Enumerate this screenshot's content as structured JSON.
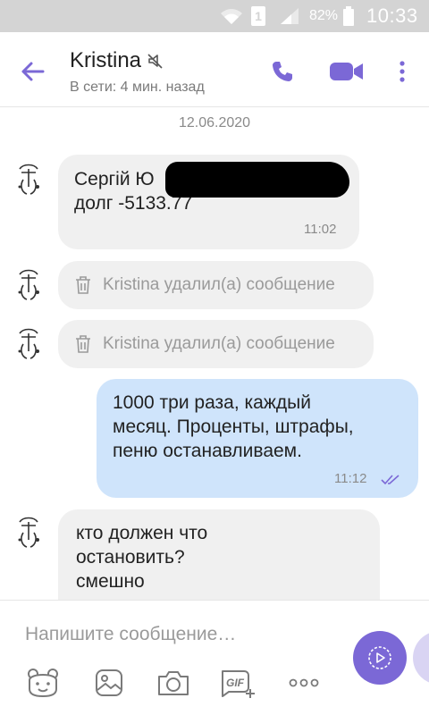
{
  "status_bar": {
    "battery_percent": "82%",
    "time": "10:33",
    "sim_label": "1"
  },
  "header": {
    "contact_name": "Kristina",
    "last_seen": "В сети: 4 мин. назад"
  },
  "conversation": {
    "date_separator": "12.06.2020",
    "messages": [
      {
        "direction": "in",
        "line1": "Сергій Ю",
        "line2": "долг -5133.77",
        "time": "11:02"
      },
      {
        "direction": "in",
        "deleted": true,
        "text": "Kristina удалил(а) сообщение"
      },
      {
        "direction": "in",
        "deleted": true,
        "text": "Kristina удалил(а) сообщение"
      },
      {
        "direction": "out",
        "lines": [
          "1000 три раза, каждый",
          "месяц. Проценты, штрафы,",
          "пеню останавливаем."
        ],
        "time": "11:12"
      },
      {
        "direction": "in",
        "lines": [
          "кто должен что",
          "остановить?",
          "смешно"
        ]
      }
    ]
  },
  "composer": {
    "placeholder": "Напишите сообщение…",
    "gif_label": "GIF"
  },
  "colors": {
    "accent": "#7b68d6",
    "incoming_bubble": "#f0f0f0",
    "outgoing_bubble": "#cfe4fb",
    "read_check": "#7b68d6"
  }
}
